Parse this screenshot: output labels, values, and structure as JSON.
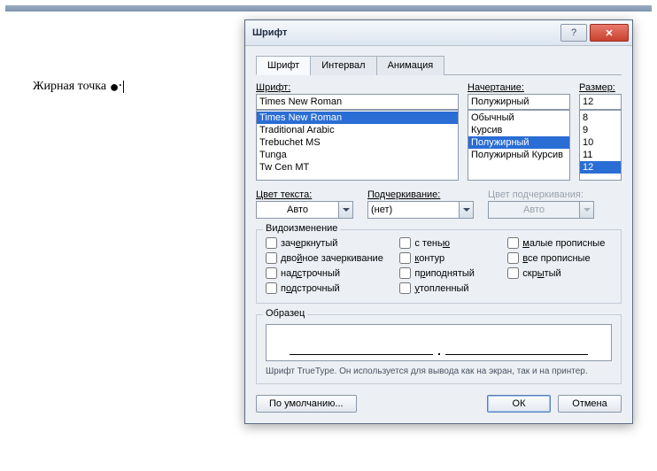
{
  "doc_text_prefix": "Жирная точка ",
  "dialog": {
    "title": "Шрифт",
    "tabs": [
      "Шрифт",
      "Интервал",
      "Анимация"
    ],
    "font": {
      "label": "Шрифт:",
      "value": "Times New Roman",
      "options": [
        "Times New Roman",
        "Traditional Arabic",
        "Trebuchet MS",
        "Tunga",
        "Tw Cen MT"
      ]
    },
    "style": {
      "label": "Начертание:",
      "value": "Полужирный",
      "options": [
        "Обычный",
        "Курсив",
        "Полужирный",
        "Полужирный Курсив"
      ]
    },
    "size": {
      "label": "Размер:",
      "value": "12",
      "options": [
        "8",
        "9",
        "10",
        "11",
        "12"
      ]
    },
    "textcolor": {
      "label": "Цвет текста:",
      "value": "Авто"
    },
    "underline": {
      "label": "Подчеркивание:",
      "value": "(нет)"
    },
    "underlinecolor": {
      "label": "Цвет подчеркивания:",
      "value": "Авто"
    },
    "effects": {
      "title": "Видоизменение",
      "col1": [
        "зачеркнутый",
        "двойное зачеркивание",
        "надстрочный",
        "подстрочный"
      ],
      "col2": [
        "с тенью",
        "контур",
        "приподнятый",
        "утопленный"
      ],
      "col3": [
        "малые прописные",
        "все прописные",
        "скрытый"
      ]
    },
    "preview_title": "Образец",
    "hint": "Шрифт TrueType. Он используется для вывода как на экран, так и на принтер.",
    "buttons": {
      "default": "По умолчанию...",
      "ok": "ОК",
      "cancel": "Отмена"
    }
  }
}
